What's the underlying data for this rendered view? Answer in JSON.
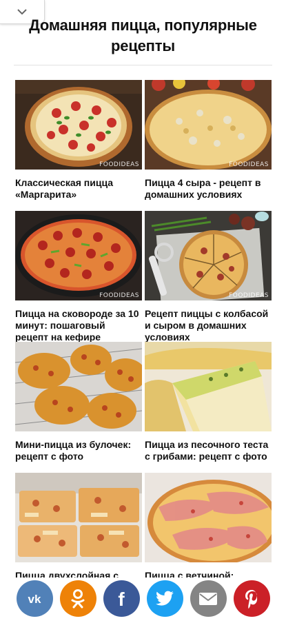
{
  "header": {
    "title": "Домашняя пицца, популярные рецепты",
    "collapse_icon": "chevron-down-icon"
  },
  "recipes": [
    {
      "caption": "Классическая пицца «Маргарита»",
      "watermark": "FOODIDEAS"
    },
    {
      "caption": "Пицца 4 сыра - рецепт в домашних условиях",
      "watermark": "FOODIDEAS"
    },
    {
      "caption": "Пицца на сковороде за 10 минут: пошаговый рецепт на кефире",
      "watermark": "FOODIDEAS"
    },
    {
      "caption": "Рецепт пиццы с колбасой и сыром в домашних условиях",
      "watermark": "FOODIDEAS"
    },
    {
      "caption": "Мини-пицца из булочек: рецепт с фото"
    },
    {
      "caption": "Пицца из песочного теста с грибами: рецепт с фото"
    },
    {
      "caption": "Пицца двухслойная с"
    },
    {
      "caption": "Пицца с ветчиной:"
    }
  ],
  "share": [
    {
      "network": "vk",
      "label": "vk",
      "color": "#5181b8",
      "icon": "vk-icon"
    },
    {
      "network": "odnoklassniki",
      "color": "#ee8208",
      "icon": "odnoklassniki-icon"
    },
    {
      "network": "facebook",
      "label": "f",
      "color": "#3b5998",
      "icon": "facebook-icon"
    },
    {
      "network": "twitter",
      "color": "#1da1f2",
      "icon": "twitter-icon"
    },
    {
      "network": "email",
      "color": "#848484",
      "icon": "email-icon"
    },
    {
      "network": "pinterest",
      "color": "#cb2027",
      "icon": "pinterest-icon"
    }
  ]
}
